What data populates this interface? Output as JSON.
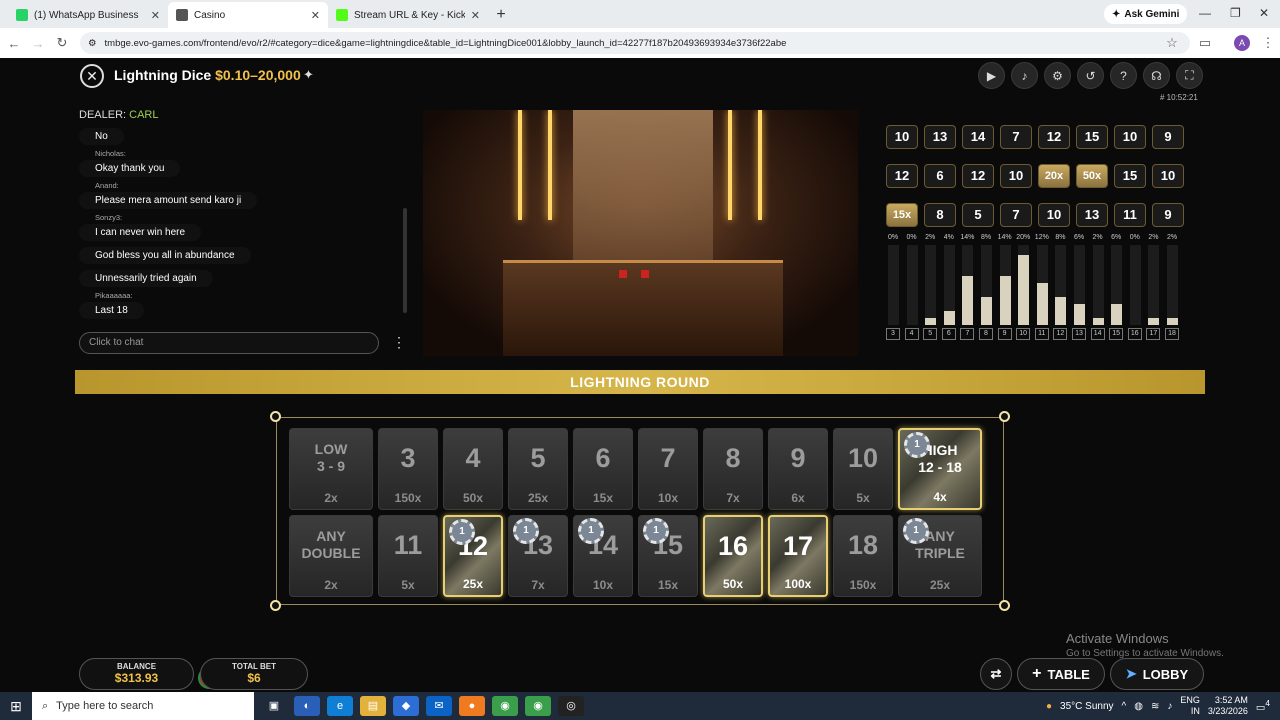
{
  "browser": {
    "tabs": [
      {
        "title": "(1) WhatsApp Business",
        "color": "#25d366"
      },
      {
        "title": "Casino",
        "color": "#555555",
        "active": true
      },
      {
        "title": "Stream URL & Key - Kick Dashb",
        "color": "#53fc18"
      }
    ],
    "ask_gemini": "Ask Gemini",
    "url": "tmbge.evo-games.com/frontend/evo/r2/#category=dice&game=lightningdice&table_id=LightningDice001&lobby_launch_id=42277f187b20493693934e3736f22abe",
    "profile_letter": "A"
  },
  "game": {
    "title": "Lightning Dice",
    "limits": "$0.10–20,000",
    "round_id": "# 10:52:21",
    "top_icons": [
      "video-icon",
      "volume-icon",
      "settings-icon",
      "history-icon",
      "help-icon",
      "headset-icon",
      "fullscreen-icon"
    ]
  },
  "chat": {
    "dealer_label": "DEALER:",
    "dealer_name": "CARL",
    "messages": [
      {
        "user": "",
        "text": "No"
      },
      {
        "user": "Nicholas:",
        "text": "Okay thank you"
      },
      {
        "user": "Anand:",
        "text": "Please mera amount send karo ji"
      },
      {
        "user": "Sonzy3:",
        "text": "I can never win here"
      },
      {
        "user": "",
        "text": "God bless you all in abundance"
      },
      {
        "user": "",
        "text": "Unnessarily tried again"
      },
      {
        "user": "Pikaaaaaa:",
        "text": "Last 18"
      }
    ],
    "placeholder": "Click to chat"
  },
  "history": {
    "row1": [
      "10",
      "13",
      "14",
      "7",
      "12",
      "15",
      "10",
      "9"
    ],
    "row2": [
      "12",
      "6",
      "12",
      "10",
      "20x",
      "50x",
      "15",
      "10"
    ],
    "row3": [
      "15x",
      "8",
      "5",
      "7",
      "10",
      "13",
      "11",
      "9"
    ]
  },
  "stats": [
    {
      "label": "3",
      "pct": "0%",
      "value": 0
    },
    {
      "label": "4",
      "pct": "0%",
      "value": 0
    },
    {
      "label": "5",
      "pct": "2%",
      "value": 2
    },
    {
      "label": "6",
      "pct": "4%",
      "value": 4
    },
    {
      "label": "7",
      "pct": "14%",
      "value": 14
    },
    {
      "label": "8",
      "pct": "8%",
      "value": 8
    },
    {
      "label": "9",
      "pct": "14%",
      "value": 14
    },
    {
      "label": "10",
      "pct": "20%",
      "value": 20
    },
    {
      "label": "11",
      "pct": "12%",
      "value": 12
    },
    {
      "label": "12",
      "pct": "8%",
      "value": 8
    },
    {
      "label": "13",
      "pct": "6%",
      "value": 6
    },
    {
      "label": "14",
      "pct": "2%",
      "value": 2
    },
    {
      "label": "15",
      "pct": "6%",
      "value": 6
    },
    {
      "label": "16",
      "pct": "0%",
      "value": 0
    },
    {
      "label": "17",
      "pct": "2%",
      "value": 2
    },
    {
      "label": "18",
      "pct": "2%",
      "value": 2
    }
  ],
  "banner": "LIGHTNING ROUND",
  "board": {
    "top": [
      {
        "label": "LOW\n3 - 9",
        "mult": "2x",
        "wide": true
      },
      {
        "label": "3",
        "mult": "150x"
      },
      {
        "label": "4",
        "mult": "50x"
      },
      {
        "label": "5",
        "mult": "25x"
      },
      {
        "label": "6",
        "mult": "15x"
      },
      {
        "label": "7",
        "mult": "10x"
      },
      {
        "label": "8",
        "mult": "7x"
      },
      {
        "label": "9",
        "mult": "6x"
      },
      {
        "label": "10",
        "mult": "5x"
      },
      {
        "label": "HIGH\n12 - 18",
        "mult": "4x",
        "wide": true,
        "lit": true,
        "chip": "1"
      }
    ],
    "bottom": [
      {
        "label": "ANY\nDOUBLE",
        "mult": "2x",
        "wide": true
      },
      {
        "label": "11",
        "mult": "5x"
      },
      {
        "label": "12",
        "mult": "25x",
        "lit": true,
        "chip": "1"
      },
      {
        "label": "13",
        "mult": "7x",
        "chip": "1"
      },
      {
        "label": "14",
        "mult": "10x",
        "chip": "1"
      },
      {
        "label": "15",
        "mult": "15x",
        "chip": "1"
      },
      {
        "label": "16",
        "mult": "50x",
        "lit": true
      },
      {
        "label": "17",
        "mult": "100x",
        "lit": true
      },
      {
        "label": "18",
        "mult": "150x"
      },
      {
        "label": "ANY\nTRIPLE",
        "mult": "25x",
        "wide": true,
        "chip": "1"
      }
    ]
  },
  "footer": {
    "balance_label": "BALANCE",
    "balance_value": "$313.93",
    "total_bet_label": "TOTAL BET",
    "total_bet_value": "$6",
    "table_label": "TABLE",
    "lobby_label": "LOBBY"
  },
  "watermark": {
    "title": "Activate Windows",
    "subtitle": "Go to Settings to activate Windows."
  },
  "taskbar": {
    "search_placeholder": "Type here to search",
    "weather": "35°C  Sunny",
    "lang1": "ENG",
    "lang2": "IN",
    "time": "3:52 AM",
    "date": "3/23/2026",
    "notif_count": "4"
  }
}
